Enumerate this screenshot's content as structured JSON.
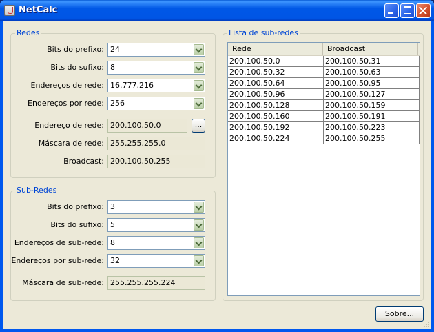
{
  "window": {
    "title": "NetCalc"
  },
  "redes": {
    "title": "Redes",
    "rows": [
      {
        "label": "Bits do prefixo:",
        "value": "24"
      },
      {
        "label": "Bits do sufixo:",
        "value": "8"
      },
      {
        "label": "Endereços de rede:",
        "value": "16.777.216"
      },
      {
        "label": "Endereços por rede:",
        "value": "256"
      }
    ],
    "endereco_label": "Endereço de rede:",
    "endereco_value": "200.100.50.0",
    "browse_label": "...",
    "mascara_label": "Máscara de rede:",
    "mascara_value": "255.255.255.0",
    "broadcast_label": "Broadcast:",
    "broadcast_value": "200.100.50.255"
  },
  "subredes": {
    "title": "Sub-Redes",
    "rows": [
      {
        "label": "Bits do prefixo:",
        "value": "3"
      },
      {
        "label": "Bits do sufixo:",
        "value": "5"
      },
      {
        "label": "Endereços de sub-rede:",
        "value": "8"
      },
      {
        "label": "Endereços por sub-rede:",
        "value": "32"
      }
    ],
    "mascara_label": "Máscara de sub-rede:",
    "mascara_value": "255.255.255.224"
  },
  "lista": {
    "title": "Lista de sub-redes",
    "columns": [
      "Rede",
      "Broadcast"
    ],
    "rows": [
      [
        "200.100.50.0",
        "200.100.50.31"
      ],
      [
        "200.100.50.32",
        "200.100.50.63"
      ],
      [
        "200.100.50.64",
        "200.100.50.95"
      ],
      [
        "200.100.50.96",
        "200.100.50.127"
      ],
      [
        "200.100.50.128",
        "200.100.50.159"
      ],
      [
        "200.100.50.160",
        "200.100.50.191"
      ],
      [
        "200.100.50.192",
        "200.100.50.223"
      ],
      [
        "200.100.50.224",
        "200.100.50.255"
      ]
    ]
  },
  "sobre_label": "Sobre..."
}
